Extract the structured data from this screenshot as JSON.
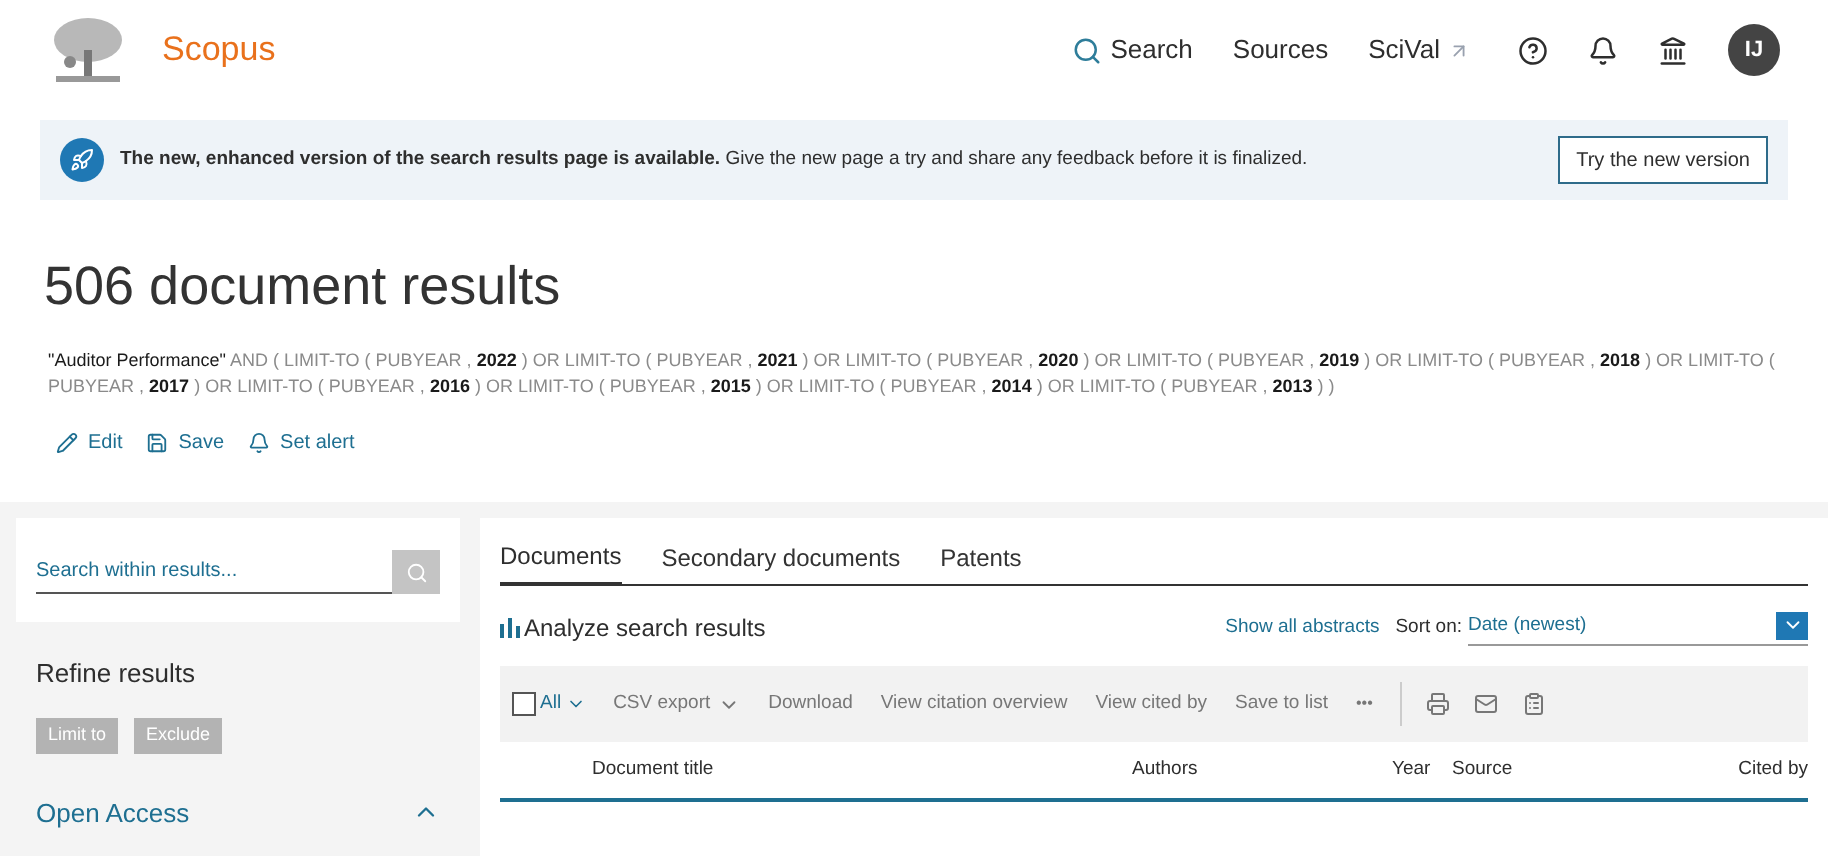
{
  "header": {
    "brand": "Scopus",
    "nav": [
      {
        "label": "Search",
        "kind": "search"
      },
      {
        "label": "Sources",
        "kind": "plain"
      },
      {
        "label": "SciVal",
        "kind": "external"
      }
    ],
    "avatar": "IJ"
  },
  "banner": {
    "bold": "The new, enhanced version of the search results page is available.",
    "text": "Give the new page a try and share any feedback before it is finalized.",
    "button": "Try the new version"
  },
  "title": "506 document results",
  "query": [
    {
      "kind": "term",
      "text": "\"Auditor Performance\""
    },
    {
      "kind": "op",
      "text": "AND ( LIMIT-TO ( PUBYEAR ,"
    },
    {
      "kind": "value",
      "text": "2022"
    },
    {
      "kind": "op",
      "text": ") OR LIMIT-TO ( PUBYEAR ,"
    },
    {
      "kind": "value",
      "text": "2021"
    },
    {
      "kind": "op",
      "text": ") OR LIMIT-TO ( PUBYEAR ,"
    },
    {
      "kind": "value",
      "text": "2020"
    },
    {
      "kind": "op",
      "text": ") OR LIMIT-TO ( PUBYEAR ,"
    },
    {
      "kind": "value",
      "text": "2019"
    },
    {
      "kind": "op",
      "text": ") OR LIMIT-TO ( PUBYEAR ,"
    },
    {
      "kind": "value",
      "text": "2018"
    },
    {
      "kind": "op",
      "text": ") OR LIMIT-TO ( PUBYEAR ,"
    },
    {
      "kind": "value",
      "text": "2017"
    },
    {
      "kind": "op",
      "text": ") OR LIMIT-TO ( PUBYEAR ,"
    },
    {
      "kind": "value",
      "text": "2016"
    },
    {
      "kind": "op",
      "text": ") OR LIMIT-TO ( PUBYEAR ,"
    },
    {
      "kind": "value",
      "text": "2015"
    },
    {
      "kind": "op",
      "text": ") OR LIMIT-TO ( PUBYEAR ,"
    },
    {
      "kind": "value",
      "text": "2014"
    },
    {
      "kind": "op",
      "text": ") OR LIMIT-TO ( PUBYEAR ,"
    },
    {
      "kind": "value",
      "text": "2013"
    },
    {
      "kind": "op",
      "text": ") )"
    }
  ],
  "actions": [
    {
      "label": "Edit",
      "kind": "edit"
    },
    {
      "label": "Save",
      "kind": "save"
    },
    {
      "label": "Set alert",
      "kind": "alert"
    }
  ],
  "sidebar": {
    "search": {
      "placeholder": "Search within results..."
    },
    "refine": "Refine results",
    "buttons": [
      "Limit to",
      "Exclude"
    ],
    "facet": {
      "label": "Open Access",
      "expanded": true
    }
  },
  "tabs": [
    {
      "label": "Documents",
      "selected": true
    },
    {
      "label": "Secondary documents",
      "selected": false
    },
    {
      "label": "Patents",
      "selected": false
    }
  ],
  "analyze": "Analyze search results",
  "show_abstracts": "Show all abstracts",
  "sort": {
    "label": "Sort on:",
    "value": "Date (newest)"
  },
  "toolbar": {
    "select_all": {
      "label": "All",
      "checked": false
    },
    "items": [
      "CSV export",
      "Download",
      "View citation overview",
      "View cited by",
      "Save to list"
    ],
    "more": "•••"
  },
  "columns": [
    "Document title",
    "Authors",
    "Year",
    "Source",
    "Cited by"
  ]
}
